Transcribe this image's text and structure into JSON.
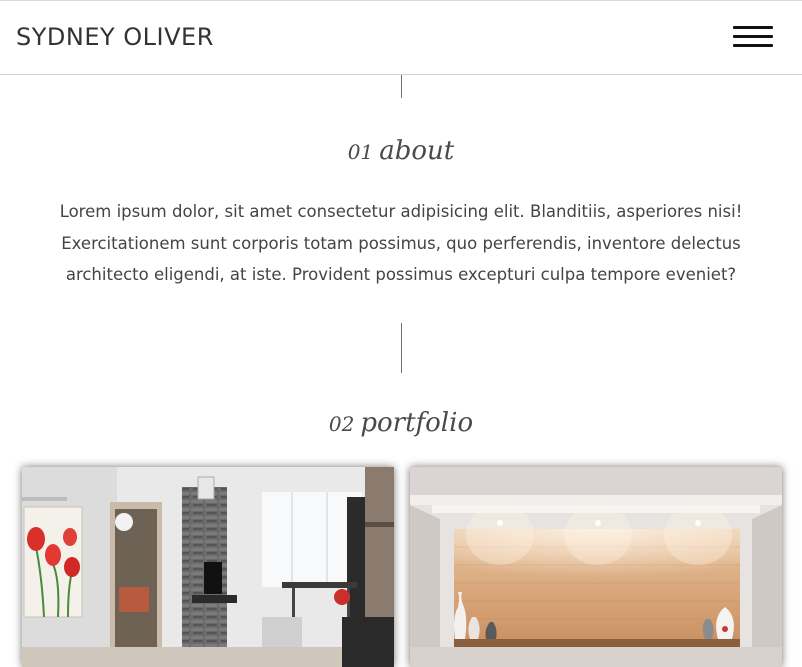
{
  "header": {
    "brand": "SYDNEY OLIVER",
    "menu_icon": "hamburger-menu-icon"
  },
  "about": {
    "number": "01",
    "title": "about",
    "text": "Lorem ipsum dolor, sit amet consectetur adipisicing elit. Blanditiis, asperiores nisi! Exercitationem sunt corporis totam possimus, quo perferendis, inventore delectus architecto eligendi, at iste. Provident possimus excepturi culpa tempore eveniet?"
  },
  "portfolio": {
    "number": "02",
    "title": "portfolio"
  }
}
